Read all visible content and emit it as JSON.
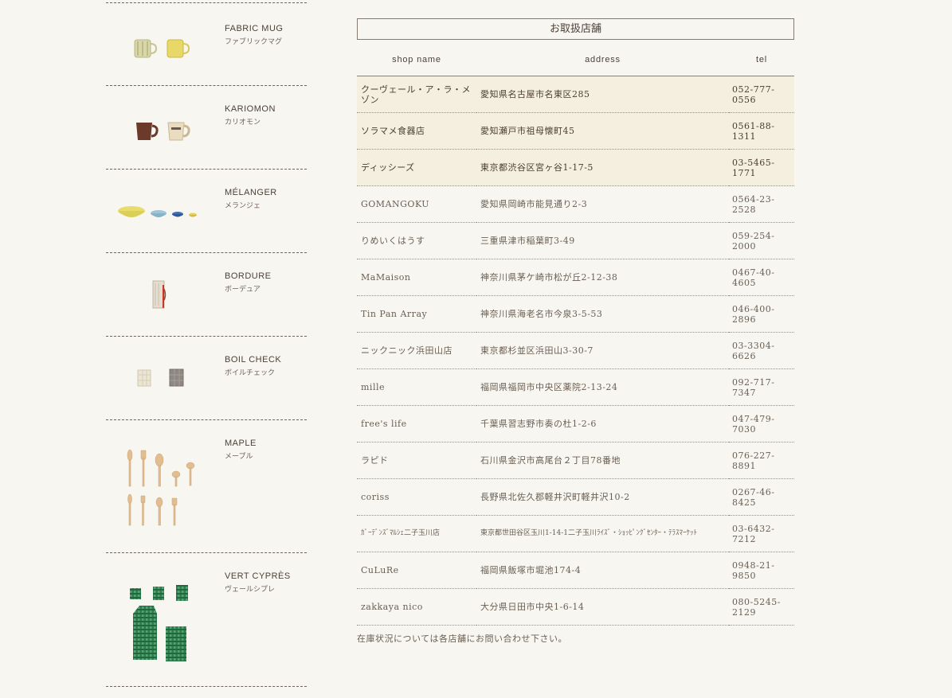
{
  "sidebar": {
    "items": [
      {
        "name_en": "FABRIC MUG",
        "name_jp": "ファブリックマグ"
      },
      {
        "name_en": "KARIOMON",
        "name_jp": "カリオモン"
      },
      {
        "name_en": "MÉLANGER",
        "name_jp": "メランジェ"
      },
      {
        "name_en": "BORDURE",
        "name_jp": "ボーデュア"
      },
      {
        "name_en": "BOIL CHECK",
        "name_jp": "ボイルチェック"
      },
      {
        "name_en": "MAPLE",
        "name_jp": "メープル"
      },
      {
        "name_en": "VERT CYPRÈS",
        "name_jp": "ヴェールシプレ"
      }
    ]
  },
  "main": {
    "title": "お取扱店舗",
    "columns": {
      "shop": "shop name",
      "address": "address",
      "tel": "tel"
    },
    "rows": [
      {
        "shop": "クーヴェール・ア・ラ・メゾン",
        "address": "愛知県名古屋市名東区285",
        "tel": "052-777-0556"
      },
      {
        "shop": "ソラマメ食器店",
        "address": "愛知瀬戸市祖母懐町45",
        "tel": "0561-88-1311"
      },
      {
        "shop": "ディッシーズ",
        "address": "東京都渋谷区宮ヶ谷1-17-5",
        "tel": "03-5465-1771"
      },
      {
        "shop": "GOMANGOKU",
        "address": "愛知県岡崎市能見通り2-3",
        "tel": "0564-23-2528"
      },
      {
        "shop": "りめいくはうす",
        "address": "三重県津市稲葉町3-49",
        "tel": "059-254-2000"
      },
      {
        "shop": "MaMaison",
        "address": "神奈川県茅ケ崎市松が丘2-12-38",
        "tel": "0467-40-4605"
      },
      {
        "shop": "Tin Pan Array",
        "address": "神奈川県海老名市今泉3-5-53",
        "tel": "046-400-2896"
      },
      {
        "shop": "ニックニック浜田山店",
        "address": "東京都杉並区浜田山3-30-7",
        "tel": "03-3304-6626"
      },
      {
        "shop": "mille",
        "address": "福岡県福岡市中央区薬院2-13-24",
        "tel": "092-717-7347"
      },
      {
        "shop": "free's life",
        "address": "千葉県習志野市奏の杜1-2-6",
        "tel": "047-479-7030"
      },
      {
        "shop": "ラピド",
        "address": "石川県金沢市高尾台２丁目78番地",
        "tel": "076-227-8891"
      },
      {
        "shop": "coriss",
        "address": "長野県北佐久郡軽井沢町軽井沢10-2",
        "tel": "0267-46-8425"
      },
      {
        "shop": "ｶﾞｰﾃﾞﾝｽﾞﾏﾙｼｪ二子玉川店",
        "address": "東京都世田谷区玉川1-14-1二子玉川ﾗｲｽﾞ・ｼｮｯﾋﾟﾝｸﾞｾﾝﾀｰ・ﾃﾗｽﾏｰｹｯﾄ",
        "tel": "03-6432-7212"
      },
      {
        "shop": "CuLuRe",
        "address": "福岡県飯塚市堀池174-4",
        "tel": "0948-21-9850"
      },
      {
        "shop": "zakkaya nico",
        "address": "大分県日田市中央1-6-14",
        "tel": "080-5245-2129"
      }
    ],
    "note": "在庫状況については各店舗にお問い合わせ下さい。"
  },
  "colors": {
    "background": "#f8f6f0",
    "highlight_row": "#f5efdf",
    "text": "#5a4d42",
    "green_check": "#2e7d4f"
  }
}
